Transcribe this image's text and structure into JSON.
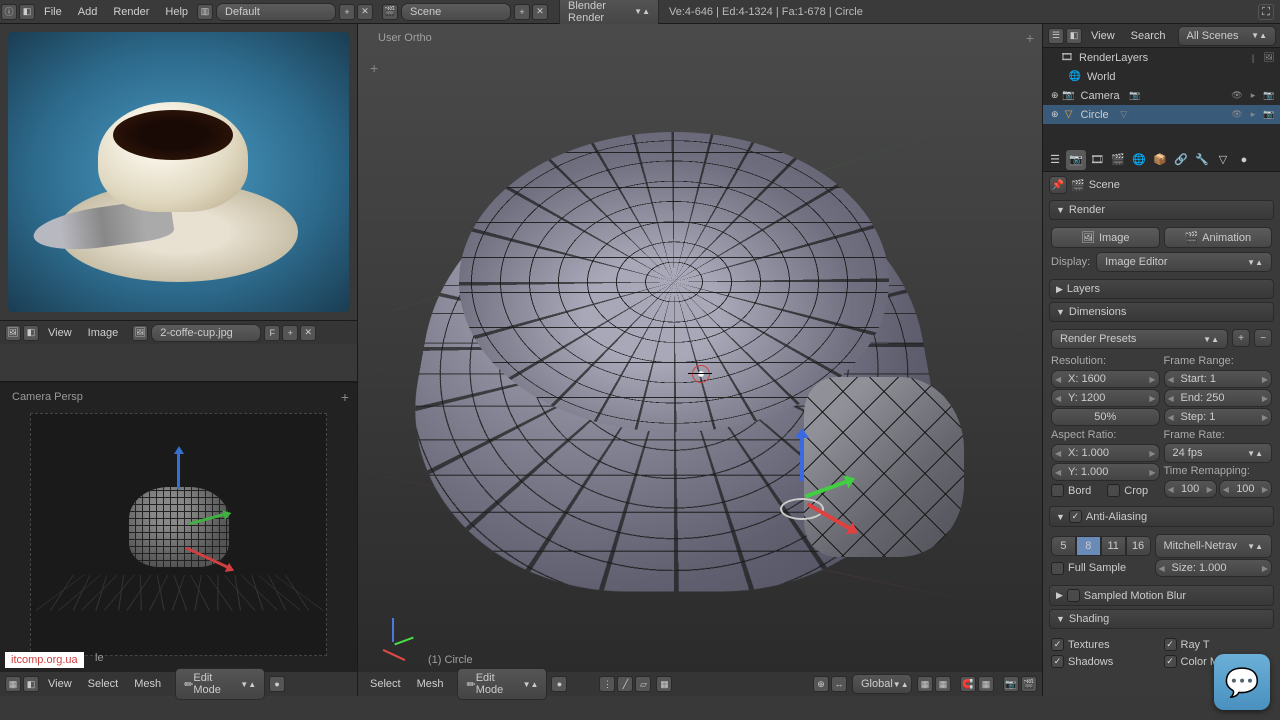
{
  "topbar": {
    "menus": [
      "File",
      "Add",
      "Render",
      "Help"
    ],
    "layout_label": "Default",
    "scene_label": "Scene",
    "engine_label": "Blender Render",
    "stats": "Ve:4-646 | Ed:4-1324 | Fa:1-678 | Circle"
  },
  "image_editor": {
    "footer_menus": [
      "View",
      "Image"
    ],
    "filename": "2-coffe-cup.jpg",
    "f_button": "F"
  },
  "camera_view": {
    "label": "Camera Persp",
    "watermark": "itcomp.org.ua",
    "obj_suffix": "le",
    "footer_menus": [
      "View",
      "Select",
      "Mesh"
    ],
    "mode": "Edit Mode"
  },
  "center_view": {
    "label": "User Ortho",
    "object_label": "(1) Circle",
    "footer_menus": [
      "Select",
      "Mesh"
    ],
    "mode": "Edit Mode",
    "orientation": "Global"
  },
  "outliner": {
    "header_menus": [
      "View",
      "Search"
    ],
    "filter": "All Scenes",
    "items": [
      {
        "icon": "🎬",
        "label": "RenderLayers",
        "indent": 16
      },
      {
        "icon": "🌐",
        "label": "World",
        "indent": 24
      },
      {
        "icon": "📷",
        "label": "Camera",
        "indent": 16,
        "has_children": true
      },
      {
        "icon": "🔺",
        "label": "Circle",
        "indent": 16,
        "has_children": true,
        "selected": true
      }
    ]
  },
  "properties": {
    "crumb_scene": "Scene",
    "panels": {
      "render": {
        "title": "Render",
        "image_btn": "Image",
        "anim_btn": "Animation",
        "display_label": "Display:",
        "display_value": "Image Editor"
      },
      "layers": {
        "title": "Layers"
      },
      "dimensions": {
        "title": "Dimensions",
        "presets": "Render Presets",
        "resolution_label": "Resolution:",
        "frame_range_label": "Frame Range:",
        "res_x": "X: 1600",
        "res_y": "Y: 1200",
        "res_pct": "50%",
        "frame_start": "Start: 1",
        "frame_end": "End: 250",
        "frame_step": "Step: 1",
        "aspect_label": "Aspect Ratio:",
        "aspect_x": "X: 1.000",
        "aspect_y": "Y: 1.000",
        "frame_rate_label": "Frame Rate:",
        "frame_rate": "24 fps",
        "time_remap_label": "Time Remapping:",
        "tr_old": "100",
        "tr_new": "100",
        "bord": "Bord",
        "crop": "Crop"
      },
      "aa": {
        "title": "Anti-Aliasing",
        "samples": [
          "5",
          "8",
          "11",
          "16"
        ],
        "active_sample": "8",
        "filter": "Mitchell-Netrav",
        "full_sample": "Full Sample",
        "size_label": "Size: 1.000"
      },
      "motion_blur": {
        "title": "Sampled Motion Blur"
      },
      "shading": {
        "title": "Shading",
        "textures": "Textures",
        "shadows": "Shadows",
        "raytracing": "Ray T",
        "color_mgmt": "Color Managem"
      }
    }
  }
}
